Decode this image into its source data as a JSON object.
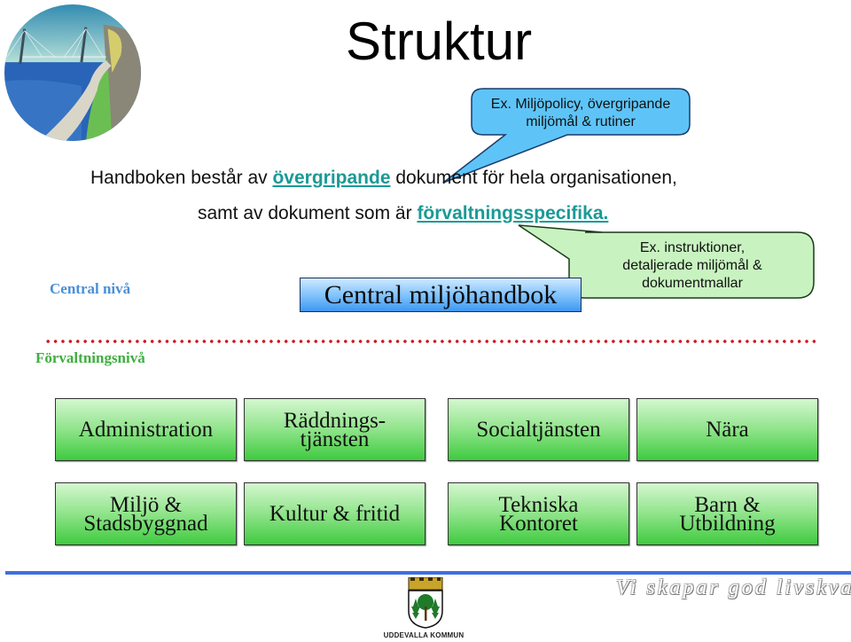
{
  "slide": {
    "title": "Struktur",
    "intro": {
      "line1_prefix": "Handboken består av ",
      "line1_highlight": "övergripande",
      "line1_suffix": " dokument för hela organisationen,",
      "line2_prefix": "samt av dokument som är ",
      "line2_highlight": "förvaltningsspecifika",
      "line2_suffix": "."
    },
    "callouts": [
      {
        "line1": "Ex. Miljöpolicy, övergripande",
        "line2": "miljömål & rutiner",
        "color": "#5ec4f7"
      },
      {
        "line1": "Ex. instruktioner,",
        "line2": "detaljerade miljömål &",
        "line3": "dokumentmallar",
        "color": "#c8f3c0"
      }
    ],
    "levels": {
      "central": "Central nivå",
      "forvaltning": "Förvaltningsnivå"
    },
    "central_handbook": "Central miljöhandbok",
    "departments": [
      {
        "line1": "Administration"
      },
      {
        "line1": "Räddnings-",
        "line2": "tjänsten"
      },
      {
        "line1": "Socialtjänsten"
      },
      {
        "line1": "Nära"
      },
      {
        "line1": "Miljö &",
        "line2": "Stadsbyggnad"
      },
      {
        "line1": "Kultur & fritid"
      },
      {
        "line1": "Tekniska",
        "line2": "Kontoret"
      },
      {
        "line1": "Barn &",
        "line2": "Utbildning"
      }
    ],
    "footer": {
      "crest_caption": "UDDEVALLA KOMMUN",
      "slogan": "Vi skapar god livskvalitet"
    },
    "colors": {
      "highlight": "#1a9a96",
      "central_level": "#4a8fd8",
      "forvaltning_level": "#3fae3f",
      "divider_dots": "#d0141c",
      "footer_line": "#3f6fe0"
    }
  }
}
